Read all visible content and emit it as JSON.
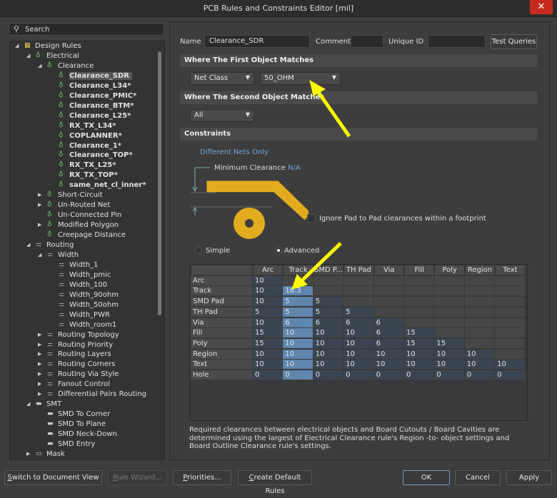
{
  "window": {
    "title": "PCB Rules and Constraints Editor [mil]",
    "close": "✕"
  },
  "search": {
    "placeholder": "Search",
    "icon": "search-icon"
  },
  "tree": [
    {
      "label": "Design Rules",
      "level": 0,
      "exp": "open",
      "icon": "folder"
    },
    {
      "label": "Electrical",
      "level": 1,
      "exp": "open",
      "icon": "electrical"
    },
    {
      "label": "Clearance",
      "level": 2,
      "exp": "open",
      "icon": "electrical"
    },
    {
      "label": "Clearance_SDR",
      "level": 3,
      "icon": "electrical",
      "bold": true,
      "selected": true
    },
    {
      "label": "Clearance_L34*",
      "level": 3,
      "icon": "electrical",
      "bold": true
    },
    {
      "label": "Clearance_PMIC*",
      "level": 3,
      "icon": "electrical",
      "bold": true
    },
    {
      "label": "Clearance_BTM*",
      "level": 3,
      "icon": "electrical",
      "bold": true
    },
    {
      "label": "Clearance_L25*",
      "level": 3,
      "icon": "electrical",
      "bold": true
    },
    {
      "label": "RX_TX_L34*",
      "level": 3,
      "icon": "electrical",
      "bold": true
    },
    {
      "label": "COPLANNER*",
      "level": 3,
      "icon": "electrical",
      "bold": true
    },
    {
      "label": "Clearance_1*",
      "level": 3,
      "icon": "electrical",
      "bold": true
    },
    {
      "label": "Clearance_TOP*",
      "level": 3,
      "icon": "electrical",
      "bold": true
    },
    {
      "label": "RX_TX_L25*",
      "level": 3,
      "icon": "electrical",
      "bold": true
    },
    {
      "label": "RX_TX_TOP*",
      "level": 3,
      "icon": "electrical",
      "bold": true
    },
    {
      "label": "same_net_cl_inner*",
      "level": 3,
      "icon": "electrical",
      "bold": true
    },
    {
      "label": "Short-Circuit",
      "level": 2,
      "exp": "closed",
      "icon": "electrical"
    },
    {
      "label": "Un-Routed Net",
      "level": 2,
      "exp": "closed",
      "icon": "electrical"
    },
    {
      "label": "Un-Connected Pin",
      "level": 2,
      "icon": "electrical"
    },
    {
      "label": "Modified Polygon",
      "level": 2,
      "exp": "closed",
      "icon": "electrical"
    },
    {
      "label": "Creepage Distance",
      "level": 2,
      "icon": "electrical"
    },
    {
      "label": "Routing",
      "level": 1,
      "exp": "open",
      "icon": "routing"
    },
    {
      "label": "Width",
      "level": 2,
      "exp": "open",
      "icon": "routing"
    },
    {
      "label": "Width_1",
      "level": 3,
      "icon": "routing"
    },
    {
      "label": "Width_pmic",
      "level": 3,
      "icon": "routing"
    },
    {
      "label": "Width_100",
      "level": 3,
      "icon": "routing"
    },
    {
      "label": "Width_90ohm",
      "level": 3,
      "icon": "routing"
    },
    {
      "label": "Width_50ohm",
      "level": 3,
      "icon": "routing"
    },
    {
      "label": "Width_PWR",
      "level": 3,
      "icon": "routing"
    },
    {
      "label": "Width_room1",
      "level": 3,
      "icon": "routing"
    },
    {
      "label": "Routing Topology",
      "level": 2,
      "exp": "closed",
      "icon": "routing"
    },
    {
      "label": "Routing Priority",
      "level": 2,
      "exp": "closed",
      "icon": "routing"
    },
    {
      "label": "Routing Layers",
      "level": 2,
      "exp": "closed",
      "icon": "routing"
    },
    {
      "label": "Routing Corners",
      "level": 2,
      "exp": "closed",
      "icon": "routing"
    },
    {
      "label": "Routing Via Style",
      "level": 2,
      "exp": "closed",
      "icon": "routing"
    },
    {
      "label": "Fanout Control",
      "level": 2,
      "exp": "closed",
      "icon": "routing"
    },
    {
      "label": "Differential Pairs Routing",
      "level": 2,
      "exp": "closed",
      "icon": "routing"
    },
    {
      "label": "SMT",
      "level": 1,
      "exp": "open",
      "icon": "smt"
    },
    {
      "label": "SMD To Corner",
      "level": 2,
      "icon": "smt"
    },
    {
      "label": "SMD To Plane",
      "level": 2,
      "icon": "smt"
    },
    {
      "label": "SMD Neck-Down",
      "level": 2,
      "icon": "smt"
    },
    {
      "label": "SMD Entry",
      "level": 2,
      "icon": "smt"
    },
    {
      "label": "Mask",
      "level": 1,
      "exp": "closed",
      "icon": "mask"
    }
  ],
  "rule": {
    "name_label": "Name",
    "name": "Clearance_SDR",
    "comment_label": "Comment",
    "comment": "",
    "uid_label": "Unique ID",
    "uid": "",
    "test_queries": "Test Queries",
    "first_header": "Where The First Object Matches",
    "first_type": "Net Class",
    "first_value": "50_OHM",
    "second_header": "Where The Second Object Matches",
    "second_type": "All",
    "constraints_header": "Constraints",
    "different_nets": "Different Nets Only",
    "min_clearance_label": "Minimum Clearance",
    "min_clearance": "N/A",
    "ignore_pad": "Ignore Pad to Pad clearances within a footprint",
    "ignore_pad_checked": false,
    "mode_simple": "Simple",
    "mode_advanced": "Advanced",
    "mode": "Advanced"
  },
  "matrix": {
    "columns": [
      "Arc",
      "Track",
      "SMD P...",
      "TH Pad",
      "Via",
      "Fill",
      "Poly",
      "Region",
      "Text"
    ],
    "highlight_column": "Track",
    "rows": [
      {
        "label": "Arc",
        "values": [
          "10"
        ]
      },
      {
        "label": "Track",
        "values": [
          "10",
          "16.3"
        ]
      },
      {
        "label": "SMD Pad",
        "values": [
          "10",
          "5",
          "5"
        ]
      },
      {
        "label": "TH Pad",
        "values": [
          "5",
          "5",
          "5",
          "5"
        ]
      },
      {
        "label": "Via",
        "values": [
          "10",
          "6",
          "6",
          "6",
          "6"
        ]
      },
      {
        "label": "Fill",
        "values": [
          "15",
          "10",
          "10",
          "10",
          "6",
          "15"
        ]
      },
      {
        "label": "Poly",
        "values": [
          "15",
          "10",
          "10",
          "10",
          "6",
          "15",
          "15"
        ]
      },
      {
        "label": "Region",
        "values": [
          "10",
          "10",
          "10",
          "10",
          "10",
          "10",
          "10",
          "10"
        ]
      },
      {
        "label": "Text",
        "values": [
          "10",
          "10",
          "10",
          "10",
          "10",
          "10",
          "10",
          "10",
          "10"
        ]
      },
      {
        "label": "Hole",
        "values": [
          "0",
          "0",
          "0",
          "0",
          "0",
          "0",
          "0",
          "0",
          "0"
        ]
      }
    ]
  },
  "note": "Required clearances between electrical objects and Board Cutouts / Board Cavities are determined using the largest of Electrical Clearance rule's Region -to- object settings and Board Outline Clearance rule's settings.",
  "buttons": {
    "switch_view": {
      "u": "S",
      "rest": "witch to Document View"
    },
    "rule_wizard": {
      "u": "R",
      "rest": "ule Wizard..."
    },
    "priorities": {
      "u": "P",
      "rest": "riorities..."
    },
    "create_default": {
      "u": "C",
      "rest": "reate Default Rules"
    },
    "ok": "OK",
    "cancel": "Cancel",
    "apply": "Apply"
  },
  "colors": {
    "accent": "#6ea5d8",
    "annotation_arrow": "#ffff00",
    "pcb_copper": "#e3ac1f",
    "highlight_cell": "#5f86ad"
  }
}
